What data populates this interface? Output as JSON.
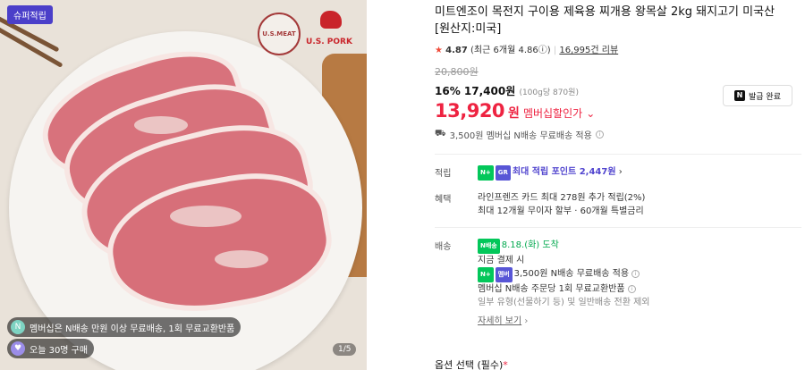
{
  "product": {
    "badge": "슈퍼적립",
    "logo_left": "U.S.MEAT",
    "logo_right": "U.S. PORK",
    "info1": "멤버십은 N배송 만원 이상 무료배송, 1회 무료교환반품",
    "info2": "오늘 30명 구매",
    "counter": "1/5",
    "title": "미트엔조이 목전지 구이용 제육용 찌개용 왕목살 2kg 돼지고기 미국산 [원산지:미국]",
    "rating": "4.87",
    "rating_detail": "(최근 6개월 4.86ⓘ)",
    "reviews": "16,995건 리뷰",
    "original_price": "20,800원",
    "sale_line": "16% 17,400원",
    "unit_price": "(100g당 870원)",
    "member_price": "13,920",
    "member_won": "원",
    "member_label": "멤버십할인가",
    "coupon": "발급 완료",
    "shipping": "3,500원 멤버십 N배송 무료배송 적용",
    "accrual_label": "적립",
    "accrual_value": "최대 적립 포인트 2,447원",
    "benefit_label": "혜택",
    "benefit1": "라인프렌즈 카드 최대 278원 추가 적립(2%)",
    "benefit2": "최대 12개월 무이자 할부 · 60개월 특별금리",
    "delivery_label": "배송",
    "delivery_date": "8.18.(화) 도착",
    "delivery_when": "지금 결제 시",
    "delivery_fee": "3,500원 N배송 무료배송 적용",
    "delivery_exchange": "멤버십 N배송 주문당 1회 무료교환반품",
    "delivery_note": "일부 유형(선물하기 등) 및 일반배송 전환 제외",
    "more": "자세히 보기",
    "option": "옵션 선택 (필수)"
  }
}
